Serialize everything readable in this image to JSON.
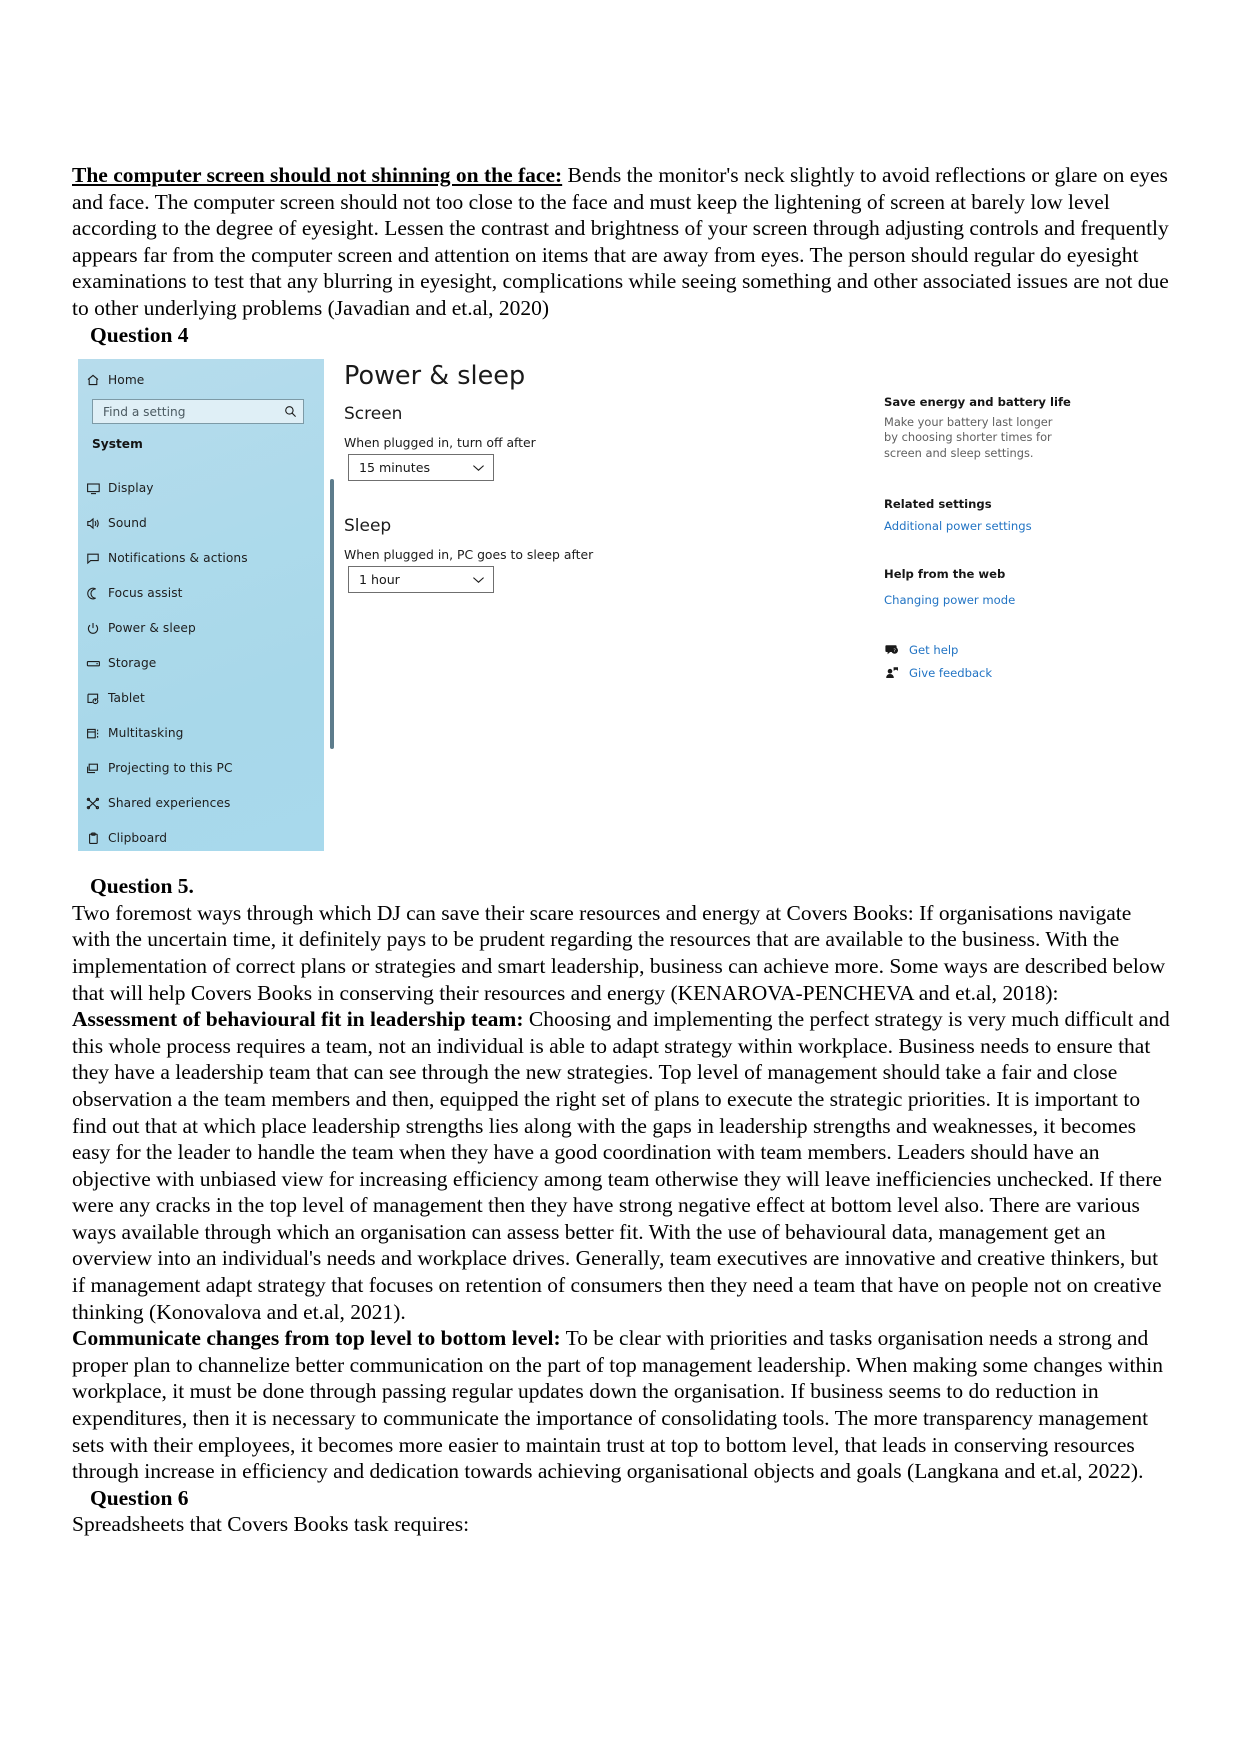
{
  "document": {
    "paragraph_1": {
      "lead_bold": "The computer screen should not shinning on the face:",
      "body": " Bends the monitor's neck slightly to avoid reflections or glare on eyes and face. The computer screen should not too close to the face and must keep the lightening of screen at barely low level according to the degree of eyesight. Lessen the contrast and brightness of your screen  through adjusting controls and frequently appears far from the computer screen and attention on items that are away from eyes. The person should regular do eyesight examinations to test that any blurring in eyesight, complications while seeing something and other associated issues are not due to other underlying problems (Javadian and et.al, 2020)"
    },
    "question_4_heading": "Question 4",
    "question_5_heading": "Question 5.",
    "paragraph_2": "Two foremost ways through which DJ can save their scare resources and energy at Covers Books: If organisations navigate with the uncertain time, it definitely pays to be prudent regarding the resources that are available to the business. With the implementation of correct plans or strategies and smart leadership, business can achieve more. Some ways are described below that will help Covers Books in conserving their resources and energy (KENAROVA-PENCHEVA and et.al, 2018):",
    "paragraph_3": {
      "lead_bold": "Assessment of behavioural fit in leadership team:",
      "body": " Choosing and implementing the perfect strategy is very much difficult and this whole process requires a team, not an individual is able to adapt strategy within workplace. Business needs to ensure that they have a leadership team that can see through the new strategies. Top level of management should take a fair and close observation a the team members and then, equipped the right set of plans to execute the strategic priorities. It is important to find out that at which place leadership strengths lies along with the gaps in leadership strengths and weaknesses, it becomes easy for the leader to handle the team when they have a good coordination with team members. Leaders should have an objective with unbiased view for increasing efficiency among team otherwise they will leave inefficiencies unchecked. If there were any cracks in the top level of management then they have strong negative effect at bottom level also. There are various ways available through which an organisation can assess better fit. With the use of behavioural data, management get an overview into an individual's needs and workplace drives. Generally, team executives are innovative and creative thinkers, but if management adapt strategy that focuses on retention of consumers then they need a team that have on people not on creative thinking (Konovalova and et.al, 2021)."
    },
    "paragraph_4": {
      "lead_bold": "Communicate changes from top level to bottom level:",
      "body": " To be clear with priorities and tasks organisation needs a strong and proper plan to channelize better communication on the part of top management leadership. When making some changes within workplace, it must be done through passing regular updates down the organisation. If business seems to do reduction in expenditures, then it is necessary to communicate the importance of consolidating tools. The more transparency management sets with their employees, it becomes more easier to maintain trust at top to bottom level, that leads in conserving resources through increase in efficiency and dedication towards achieving organisational objects and goals (Langkana and et.al, 2022)."
    },
    "question_6_heading": "Question 6",
    "paragraph_5": "Spreadsheets that Covers Books task requires:"
  },
  "settings_screenshot": {
    "sidebar": {
      "home_label": "Home",
      "search_placeholder": "Find a setting",
      "search_icon": "search-icon",
      "section_label": "System",
      "items": [
        {
          "label": "Display",
          "icon": "monitor-icon"
        },
        {
          "label": "Sound",
          "icon": "speaker-icon"
        },
        {
          "label": "Notifications & actions",
          "icon": "notification-icon"
        },
        {
          "label": "Focus assist",
          "icon": "moon-icon"
        },
        {
          "label": "Power & sleep",
          "icon": "power-icon"
        },
        {
          "label": "Storage",
          "icon": "storage-icon"
        },
        {
          "label": "Tablet",
          "icon": "tablet-icon"
        },
        {
          "label": "Multitasking",
          "icon": "multitasking-icon"
        },
        {
          "label": "Projecting to this PC",
          "icon": "projecting-icon"
        },
        {
          "label": "Shared experiences",
          "icon": "shared-experiences-icon"
        },
        {
          "label": "Clipboard",
          "icon": "clipboard-icon"
        }
      ]
    },
    "main": {
      "title": "Power & sleep",
      "screen_heading": "Screen",
      "screen_field_label": "When plugged in, turn off after",
      "screen_value": "15 minutes",
      "sleep_heading": "Sleep",
      "sleep_field_label": "When plugged in, PC goes to sleep after",
      "sleep_value": "1 hour"
    },
    "rail": {
      "save_energy_heading": "Save energy and battery life",
      "save_energy_text": "Make your battery last longer by choosing shorter times for screen and sleep settings.",
      "related_settings_heading": "Related settings",
      "related_settings_link": "Additional power settings",
      "help_heading": "Help from the web",
      "help_link": "Changing power mode",
      "get_help_label": "Get help",
      "give_feedback_label": "Give feedback"
    },
    "colors": {
      "sidebar_bg": "#a8d8ea",
      "link": "#2274c4",
      "muted_text": "#5f5f5f"
    }
  }
}
